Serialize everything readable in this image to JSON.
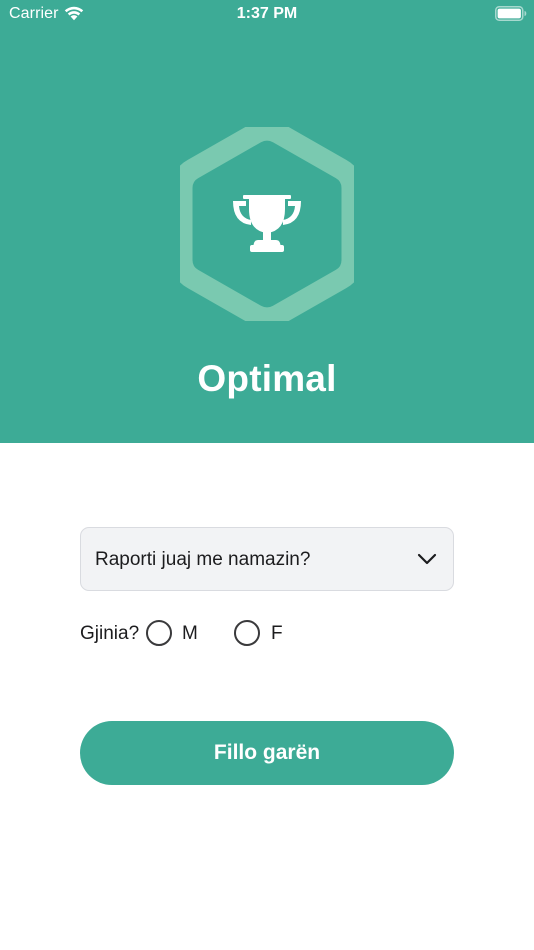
{
  "status_bar": {
    "carrier": "Carrier",
    "time": "1:37 PM",
    "icons": [
      "wifi-icon",
      "battery-icon"
    ]
  },
  "hero": {
    "background_color": "#3dab96",
    "badge_icon": "trophy-icon",
    "title": "Optimal"
  },
  "form": {
    "relation_select": {
      "label": "Raporti juaj me namazin?",
      "icon": "chevron-down-icon"
    },
    "gender": {
      "label": "Gjinia?",
      "options": [
        {
          "label": "M",
          "selected": false
        },
        {
          "label": "F",
          "selected": false
        }
      ]
    },
    "start_button": {
      "label": "Fillo garën",
      "color": "#3dab96"
    }
  }
}
